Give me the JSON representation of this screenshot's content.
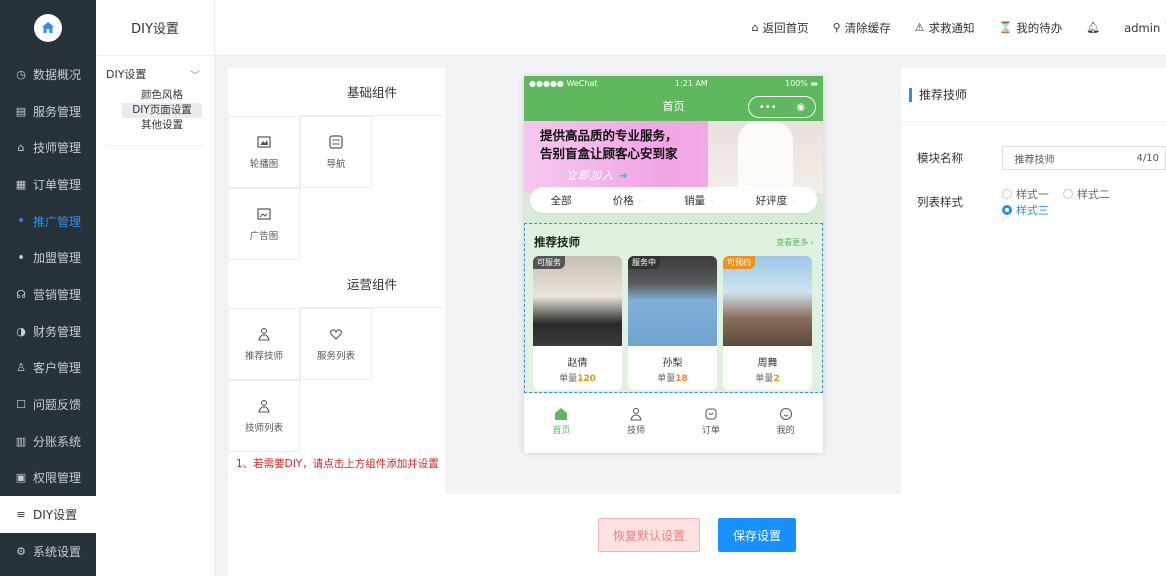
{
  "sidebar": {
    "items": [
      {
        "icon": "◷",
        "label": "数据概况"
      },
      {
        "icon": "▤",
        "label": "服务管理"
      },
      {
        "icon": "⌂",
        "label": "技师管理"
      },
      {
        "icon": "▦",
        "label": "订单管理"
      },
      {
        "icon": "ꔷ",
        "label": "推广管理"
      },
      {
        "icon": "ꔷ",
        "label": "加盟管理"
      },
      {
        "icon": "☊",
        "label": "营销管理"
      },
      {
        "icon": "◑",
        "label": "财务管理"
      },
      {
        "icon": "♙",
        "label": "客户管理"
      },
      {
        "icon": "☐",
        "label": "问题反馈"
      },
      {
        "icon": "▥",
        "label": "分账系统"
      },
      {
        "icon": "▣",
        "label": "权限管理"
      },
      {
        "icon": "≡",
        "label": "DIY设置"
      },
      {
        "icon": "⚙",
        "label": "系统设置"
      }
    ]
  },
  "subnav": {
    "title": "DIY设置",
    "group": "DIY设置",
    "items": [
      "颜色风格",
      "DIY页面设置",
      "其他设置"
    ]
  },
  "topbar": {
    "home": "返回首页",
    "clear_cache": "清除缓存",
    "sos": "求救通知",
    "todo": "我的待办",
    "user": "admin"
  },
  "components": {
    "basic_title": "基础组件",
    "basic": [
      "轮播图",
      "导航",
      "广告图"
    ],
    "ops_title": "运营组件",
    "ops": [
      "推荐技师",
      "服务列表",
      "技师列表"
    ],
    "note": "1、若需要DIY，请点击上方组件添加并设置"
  },
  "phone": {
    "carrier": "●●●●● WeChat",
    "time": "1:21 AM",
    "battery": "100%",
    "title": "首页",
    "banner_line1": "提供高品质的专业服务，",
    "banner_line2": "告别盲盒让顾客心安到家",
    "banner_line3": "立即加入",
    "filters": [
      "全部",
      "价格",
      "销量",
      "好评度"
    ],
    "rec_title": "推荐技师",
    "rec_more": "查看更多 ›",
    "cards": [
      {
        "tag": "可服务",
        "name": "赵倩",
        "count_label": "单量",
        "count": "120"
      },
      {
        "tag": "服务中",
        "name": "孙梨",
        "count_label": "单量",
        "count": "18"
      },
      {
        "tag": "可预约",
        "name": "周舞",
        "count_label": "单量",
        "count": "2"
      }
    ],
    "tabs": [
      "首页",
      "技师",
      "订单",
      "我的"
    ]
  },
  "props": {
    "title": "推荐技师",
    "name_label": "模块名称",
    "name_value": "推荐技师",
    "name_count": "4/10",
    "style_label": "列表样式",
    "styles": [
      "样式一",
      "样式二",
      "样式三"
    ]
  },
  "footer": {
    "reset": "恢复默认设置",
    "save": "保存设置"
  },
  "colors": {
    "sidebar_bg": "#273238",
    "accent": "#2d8cf0",
    "phone_green": "#5fb85d",
    "danger": "#e02020"
  }
}
